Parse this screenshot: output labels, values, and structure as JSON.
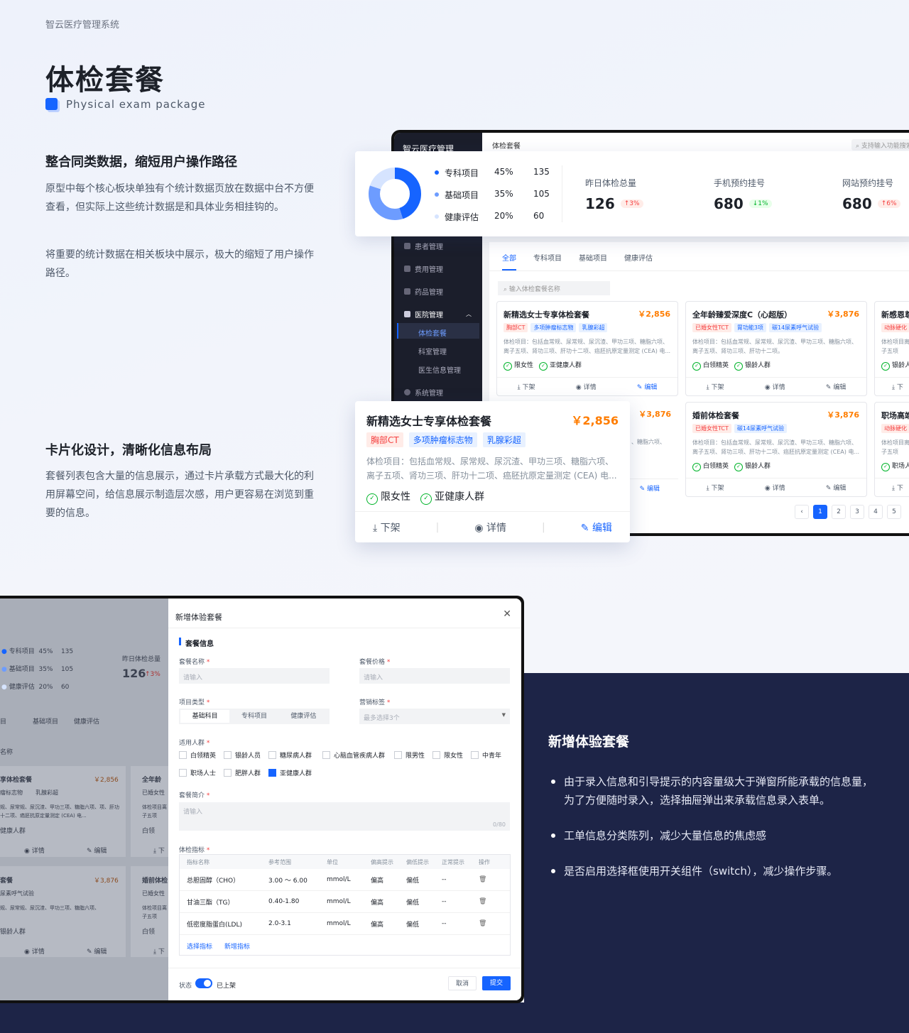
{
  "brand": "智云医疗管理系统",
  "title": "体检套餐",
  "subtitle": "Physical exam package",
  "sec1": {
    "title": "整合同类数据，缩短用户操作路径",
    "p1": "原型中每个核心板块单独有个统计数据页放在数据中台不方便查看，但实际上这些统计数据是和具体业务相挂钩的。",
    "p2": "将重要的统计数据在相关板块中展示，极大的缩短了用户操作路径。"
  },
  "sec2": {
    "title": "卡片化设计，清晰化信息布局",
    "p1": "套餐列表包含大量的信息展示，通过卡片承载方式最大化的利用屏幕空间，给信息展示制造层次感，用户更容易在浏览到重要的信息。"
  },
  "sec3": {
    "title": "新增体验套餐",
    "b1": "由于录入信息和引导提示的内容量级大于弹窗所能承载的信息量，为了方便随时录入，选择抽屉弹出来承载信息录入表单。",
    "b2": "工单信息分类陈列，减少大量信息的焦虑感",
    "b3": "是否启用选择框使用开关组件（switch），减少操作步骤。"
  },
  "app": {
    "logo": "智云医疗管理",
    "crumb": "体检套餐",
    "search": "支持输入功能搜索",
    "menu": {
      "patient": "患者管理",
      "fee": "费用管理",
      "drug": "药品管理",
      "hospital": "医院管理",
      "pkg": "体检套餐",
      "dept": "科室管理",
      "doctor": "医生信息管理",
      "sys": "系统管理"
    },
    "tabs": [
      "全部",
      "专科项目",
      "基础项目",
      "健康评估"
    ],
    "list_search": "输入体检套餐名称",
    "pages": [
      "1",
      "2",
      "3",
      "4",
      "5"
    ]
  },
  "stats": {
    "legend": [
      {
        "name": "专科项目",
        "pct": "45%",
        "val": "135",
        "color": "#1664ff"
      },
      {
        "name": "基础项目",
        "pct": "35%",
        "val": "105",
        "color": "#6d9cff"
      },
      {
        "name": "健康评估",
        "pct": "20%",
        "val": "60",
        "color": "#d6e4ff"
      }
    ],
    "k1": {
      "label": "昨日体检总量",
      "value": "126",
      "chg": "↑3%"
    },
    "k2": {
      "label": "手机预约挂号",
      "value": "680",
      "chg": "↓1%"
    },
    "k3": {
      "label": "网站预约挂号",
      "value": "680",
      "chg": "↑6%"
    }
  },
  "cards": {
    "c1": {
      "title": "新精选女士专享体检套餐",
      "price": "￥2,856",
      "t1": "胸部CT",
      "t2": "多项肿瘤标志物",
      "t3": "乳腺彩超",
      "desc": "体检项目：包括血常规、尿常规、尿沉渣、甲功三项、糖脂六项、离子五项、肾功三项、肝功十二项、癌胚抗原定量测定 (CEA) 电...",
      "g1": "限女性",
      "g2": "亚健康人群"
    },
    "c2": {
      "title": "全年龄臻爱深度C（心超版）",
      "price": "￥3,876",
      "t1": "已婚女性TCT",
      "t2": "胃功能3项",
      "t3": "碳14尿素呼气试验",
      "desc": "体检项目：包括血常规、尿常规、尿沉渣、甲功三项、糖脂六项、离子五项、肾功三项、肝功十二项。",
      "g1": "白领精英",
      "g2": "银龄人群"
    },
    "c3": {
      "title": "新感恩尊",
      "t1": "动脉硬化",
      "desc": "体检项目离子五项",
      "g1": "银龄人"
    },
    "c4": {
      "price": "￥3,876",
      "desc": "、糖脂六项、"
    },
    "c5": {
      "title": "婚前体检套餐",
      "price": "￥3,876",
      "t1": "已婚女性TCT",
      "t2": "碳14尿素呼气试验",
      "desc": "体检项目：包括血常规、尿常规、尿沉渣、甲功三项、糖脂六项、离子五项、肾功三项、肝功十二项、癌胚抗原定量测定 (CEA) 电...",
      "g1": "白领精英",
      "g2": "银龄人群"
    },
    "c6": {
      "title": "职场高端",
      "t1": "动脉硬化",
      "desc": "体检项目离子五项",
      "g1": "职场人"
    },
    "acts": {
      "off": "下架",
      "detail": "详情",
      "edit": "编辑"
    }
  },
  "modal": {
    "title": "新增体验套餐",
    "section": "套餐信息",
    "name": "套餐名称",
    "price": "套餐价格",
    "ph": "请输入",
    "type": "项目类型",
    "seg": [
      "基础科目",
      "专科项目",
      "健康评估"
    ],
    "mtag": "营销标签",
    "mtag_ph": "最多选择3个",
    "crowd": "适用人群",
    "crowds": [
      "白领精英",
      "银龄人员",
      "糖尿病人群",
      "心脑血管疾病人群",
      "限男性",
      "限女性",
      "中青年",
      "职场人士",
      "肥胖人群",
      "亚健康人群"
    ],
    "intro": "套餐简介",
    "count": "0/80",
    "ind": "体检指标",
    "cols": [
      "指标名称",
      "参考范围",
      "单位",
      "偏高提示",
      "偏低提示",
      "正常提示",
      "操作"
    ],
    "rows": [
      [
        "总胆固醇（CHO）",
        "3.00 ～ 6.00",
        "mmol/L",
        "偏高",
        "偏低",
        "--"
      ],
      [
        "甘油三酯（TG）",
        "0.40-1.80",
        "mmol/L",
        "偏高",
        "偏低",
        "--"
      ],
      [
        "低密度脂蛋白(LDL)",
        "2.0-3.1",
        "mmol/L",
        "偏高",
        "偏低",
        "--"
      ]
    ],
    "sel": "选择指标",
    "add": "新增指标",
    "status": "状态",
    "on": "已上架",
    "cancel": "取消",
    "submit": "提交"
  },
  "bg": {
    "l1": "专科项目",
    "p1": "45%",
    "v1": "135",
    "l2": "基础项目",
    "p2": "35%",
    "v2": "105",
    "l3": "健康评估",
    "p3": "20%",
    "v3": "60",
    "kl": "昨日体检总量",
    "kv": "126",
    "kc": "↑3%",
    "tab1": "目",
    "tab2": "基础项目",
    "tab3": "健康评估",
    "srch": "名称",
    "c1t": "享体检套餐",
    "c1p": "￥2,856",
    "c1a": "瘤标志物",
    "c1b": "乳腺彩超",
    "c1d": "规、尿常规、尿沉渣、甲功三项、糖脂六项、项、肝功十二项、癌胚抗原定量测定 (CEA) 电...",
    "c1g": "健康人群",
    "c2t": "全年龄",
    "c2a": "已婚女性",
    "c2d": "体检项目离子五项",
    "c2g": "白领",
    "c3t": "套餐",
    "c3p": "￥3,876",
    "c3a": "尿素呼气试验",
    "c3d": "规、尿常规、尿沉渣、甲功三项、糖脂六项、",
    "c3g": "银龄人群",
    "c4t": "婚前体检",
    "c4a": "已婚女性",
    "c4d": "体检项目离子五项",
    "c4g": "白领",
    "detail": "详情",
    "edit": "编辑",
    "off": "下"
  }
}
